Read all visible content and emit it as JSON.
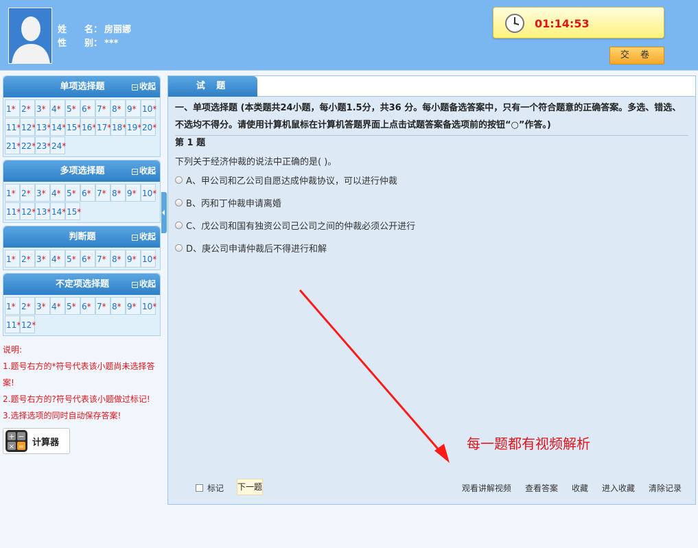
{
  "header": {
    "name_key": "姓　　名：",
    "name_value": "房丽娜",
    "gender_key": "性　　别：",
    "gender_value": "***",
    "timer": "01:14:53",
    "submit_label": "交 卷"
  },
  "sections": [
    {
      "title": "单项选择题",
      "collapse": "收起",
      "count": 24
    },
    {
      "title": "多项选择题",
      "collapse": "收起",
      "count": 15
    },
    {
      "title": "判断题",
      "collapse": "收起",
      "count": 10
    },
    {
      "title": "不定项选择题",
      "collapse": "收起",
      "count": 12
    }
  ],
  "star": "*",
  "notes": {
    "title": "说明:",
    "line1": "1.题号右方的*符号代表该小题尚未选择答案!",
    "line2": "2.题号右方的?符号代表该小题做过标记!",
    "line3": "3.选择选项的同时自动保存答案!"
  },
  "calculator_label": "计算器",
  "main": {
    "tab_label": "试 题",
    "section_desc": "一、单项选择题 (本类题共24小题，每小题1.5分，共36 分。每小题备选答案中，只有一个符合题意的正确答案。多选、错选、不选均不得分。请使用计算机鼠标在计算机答题界面上点击试题答案备选项前的按钮“○”作答。)",
    "question_number": "第 1 题",
    "question_text": "下列关于经济仲裁的说法中正确的是( )。",
    "options": [
      "A、甲公司和乙公司自愿达成仲裁协议，可以进行仲裁",
      "B、丙和丁仲裁申请离婚",
      "C、戊公司和国有独资公司己公司之间的仲裁必须公开进行",
      "D、庚公司申请仲裁后不得进行和解"
    ],
    "annotation": "每一题都有视频解析",
    "mark_label": "标记",
    "next_label": "下一题",
    "links": [
      "观看讲解视频",
      "查看答案",
      "收藏",
      "进入收藏",
      "清除记录"
    ]
  },
  "colors": {
    "accent": "#2f7fc7",
    "header_bg": "#7ab6ef",
    "timer_text": "#e0141a",
    "note_text": "#e0141a"
  }
}
